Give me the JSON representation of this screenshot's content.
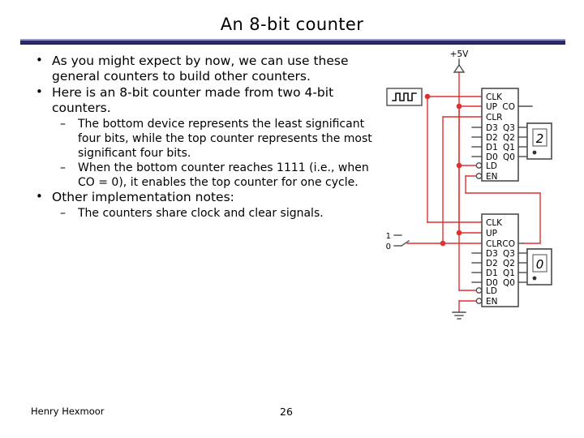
{
  "slide": {
    "title": "An 8-bit counter",
    "rule_color": "#2b2b6b",
    "footer": {
      "author": "Henry Hexmoor",
      "page_number": "26"
    }
  },
  "body": {
    "bullet_glyph_level1": "•",
    "bullet_glyph_level2": "–",
    "items": [
      {
        "level": 1,
        "text": "As you might expect by now, we can use these general counters to build other counters."
      },
      {
        "level": 1,
        "text": "Here is an 8-bit counter made from two 4-bit counters."
      },
      {
        "level": 2,
        "text": "The bottom device represents the least significant four bits, while the top counter represents the most significant four bits."
      },
      {
        "level": 2,
        "text": "When the bottom counter reaches 1111 (i.e., when CO = 0), it enables the top counter for one cycle."
      },
      {
        "level": 1,
        "text": "Other implementation notes:"
      },
      {
        "level": 2,
        "text": "The counters share clock and clear signals."
      }
    ]
  },
  "circuit": {
    "wire_color": "#e03030",
    "body_color": "#4d4d4d",
    "labels": {
      "supply": "+5V",
      "switch_high": "1",
      "switch_low": "0"
    },
    "top_counter": {
      "name": "top-counter",
      "inputs_left": [
        "CLK",
        "UP",
        "CLR"
      ],
      "data_inputs": [
        "D3",
        "D2",
        "D1",
        "D0"
      ],
      "control_inputs": [
        "LD",
        "EN"
      ],
      "outputs_right": [
        "CO",
        "Q3",
        "Q2",
        "Q1",
        "Q0"
      ],
      "display_value": "2"
    },
    "bottom_counter": {
      "name": "bottom-counter",
      "inputs_left": [
        "CLK",
        "UP",
        "CLR"
      ],
      "data_inputs": [
        "D3",
        "D2",
        "D1",
        "D0"
      ],
      "control_inputs": [
        "LD",
        "EN"
      ],
      "outputs_right": [
        "CO",
        "Q3",
        "Q2",
        "Q1",
        "Q0"
      ],
      "display_value": "0"
    }
  }
}
